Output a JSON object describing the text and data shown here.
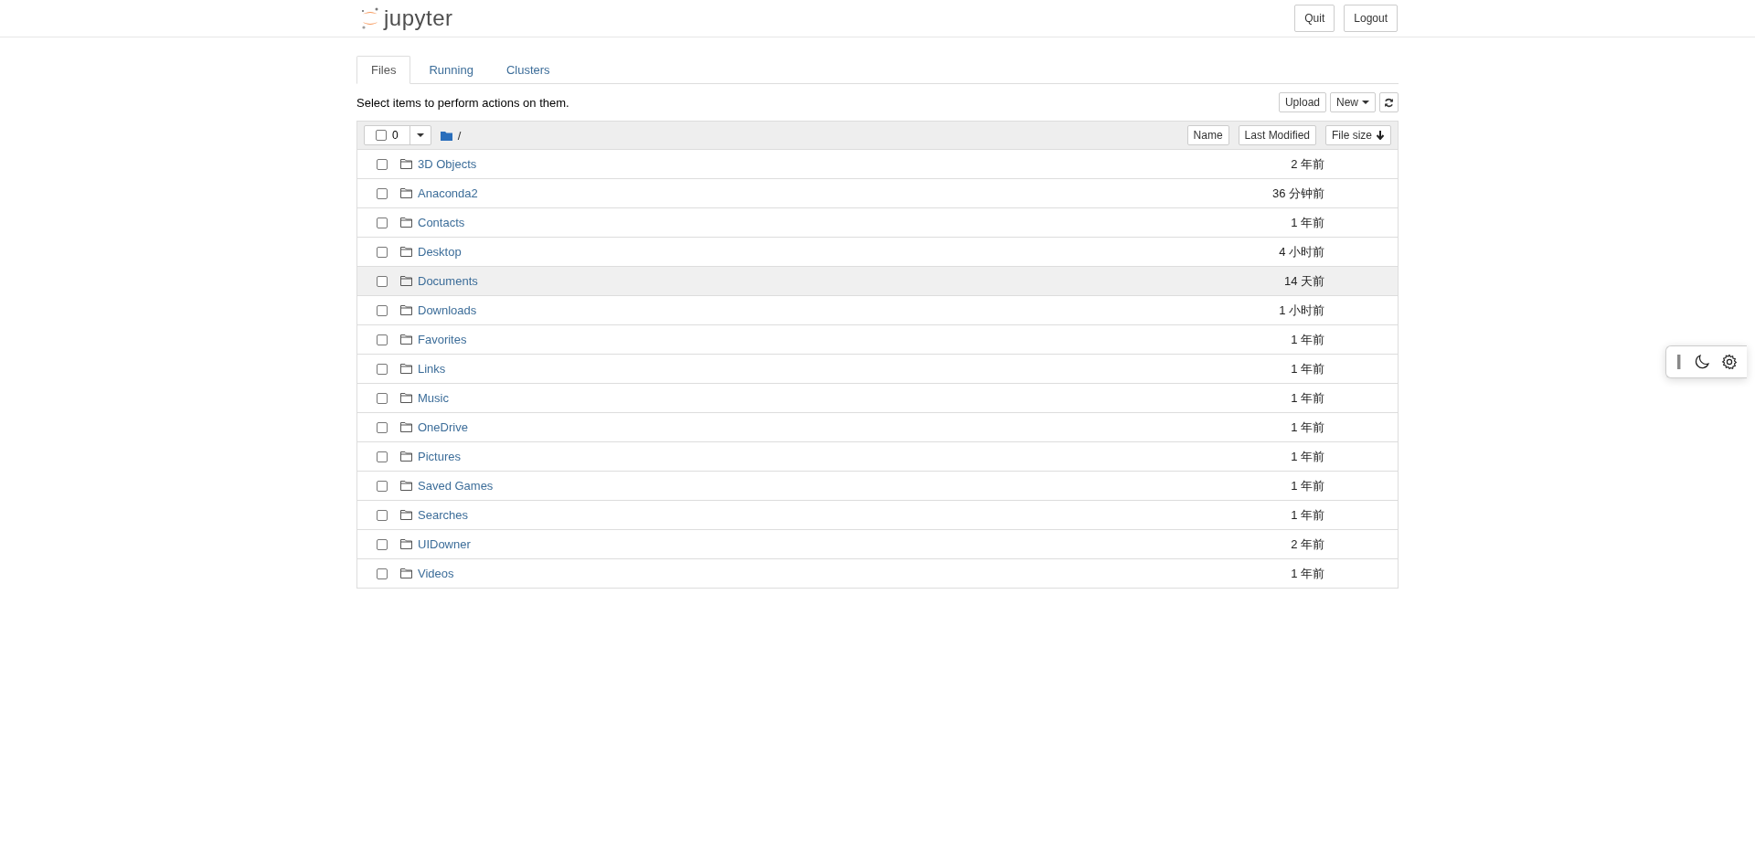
{
  "header": {
    "logo_text": "jupyter",
    "buttons": [
      "Quit",
      "Logout"
    ]
  },
  "tabs": [
    {
      "label": "Files",
      "selected": true
    },
    {
      "label": "Running",
      "selected": false
    },
    {
      "label": "Clusters",
      "selected": false
    }
  ],
  "toolbar": {
    "hint": "Select items to perform actions on them.",
    "upload": "Upload",
    "new": "New",
    "selected_count": "0",
    "path": "/"
  },
  "columns": {
    "name": "Name",
    "last_modified": "Last Modified",
    "file_size": "File size"
  },
  "rows": [
    {
      "name": "3D Objects",
      "modified": "2 年前",
      "checked": false,
      "highlighted": false
    },
    {
      "name": "Anaconda2",
      "modified": "36 分钟前",
      "checked": false,
      "highlighted": false
    },
    {
      "name": "Contacts",
      "modified": "1 年前",
      "checked": false,
      "highlighted": false
    },
    {
      "name": "Desktop",
      "modified": "4 小时前",
      "checked": false,
      "highlighted": false
    },
    {
      "name": "Documents",
      "modified": "14 天前",
      "checked": false,
      "highlighted": true
    },
    {
      "name": "Downloads",
      "modified": "1 小时前",
      "checked": false,
      "highlighted": false
    },
    {
      "name": "Favorites",
      "modified": "1 年前",
      "checked": false,
      "highlighted": false
    },
    {
      "name": "Links",
      "modified": "1 年前",
      "checked": false,
      "highlighted": false
    },
    {
      "name": "Music",
      "modified": "1 年前",
      "checked": false,
      "highlighted": false
    },
    {
      "name": "OneDrive",
      "modified": "1 年前",
      "checked": false,
      "highlighted": false
    },
    {
      "name": "Pictures",
      "modified": "1 年前",
      "checked": false,
      "highlighted": false
    },
    {
      "name": "Saved Games",
      "modified": "1 年前",
      "checked": false,
      "highlighted": false
    },
    {
      "name": "Searches",
      "modified": "1 年前",
      "checked": false,
      "highlighted": false
    },
    {
      "name": "UIDowner",
      "modified": "2 年前",
      "checked": false,
      "highlighted": false
    },
    {
      "name": "Videos",
      "modified": "1 年前",
      "checked": false,
      "highlighted": false
    }
  ]
}
